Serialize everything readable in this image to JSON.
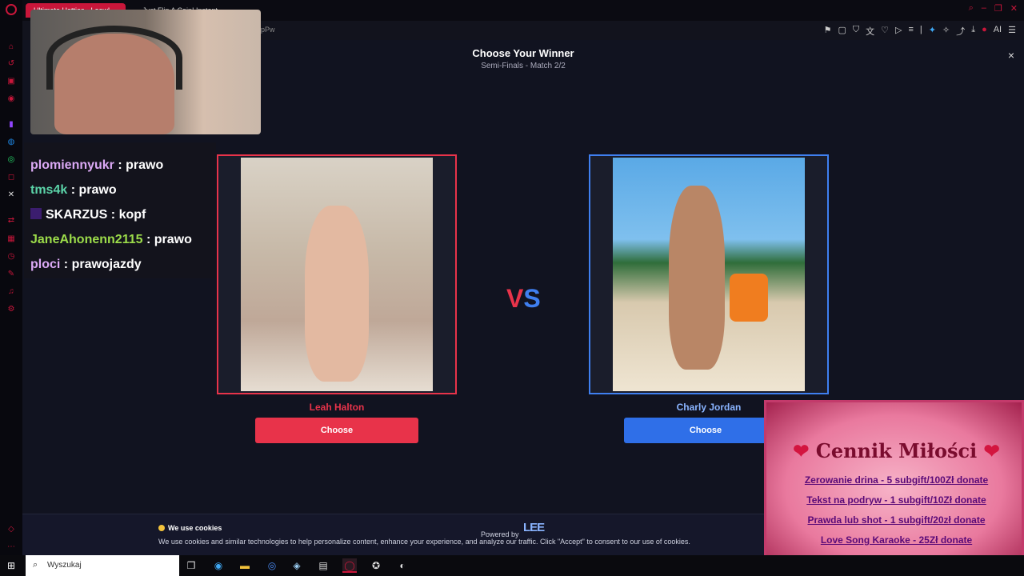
{
  "browser": {
    "tabs": [
      {
        "label": "Ultimate Hotties - Leowl..."
      },
      {
        "label": "Just Flip A Coin! Instant..."
      }
    ],
    "url_fragment": "pPw"
  },
  "modal": {
    "title": "Choose Your Winner",
    "subtitle": "Semi-Finals - Match 2/2",
    "close": "×"
  },
  "contestants": {
    "left": {
      "name": "Leah Halton",
      "button": "Choose"
    },
    "right": {
      "name": "Charly Jordan",
      "button": "Choose"
    }
  },
  "vs": {
    "v": "V",
    "s": "S"
  },
  "chat": [
    {
      "user": "plomiennyukr",
      "message": " : prawo"
    },
    {
      "user": "tms4k",
      "message": " : prawo"
    },
    {
      "user": "SKARZUS",
      "message": " : kopf"
    },
    {
      "user": "JaneAhonenn2115",
      "message": " : prawo"
    },
    {
      "user": "ploci",
      "message": " : prawojazdy"
    }
  ],
  "cookies": {
    "title": "We use cookies",
    "text": "We use cookies and similar technologies to help personalize content, enhance your experience, and analyze our traffic. Click \"Accept\" to consent to our use of cookies."
  },
  "powered_by": {
    "label": "Powered by",
    "logo": "LEE"
  },
  "price_list": {
    "title": "Cennik Miłości",
    "items": [
      "Zerowanie drina - 5 subgift/100Zł donate",
      "Tekst na podryw - 1 subgift/10Zł donate",
      "Prawda lub shot - 1 subgift/20zł donate",
      "Love Song Karaoke - 25Zł donate"
    ]
  },
  "taskbar": {
    "search_placeholder": "Wyszukaj"
  },
  "colors": {
    "accent_red": "#e8334a",
    "accent_blue": "#3f7ff0",
    "opera_red": "#c9163a"
  }
}
